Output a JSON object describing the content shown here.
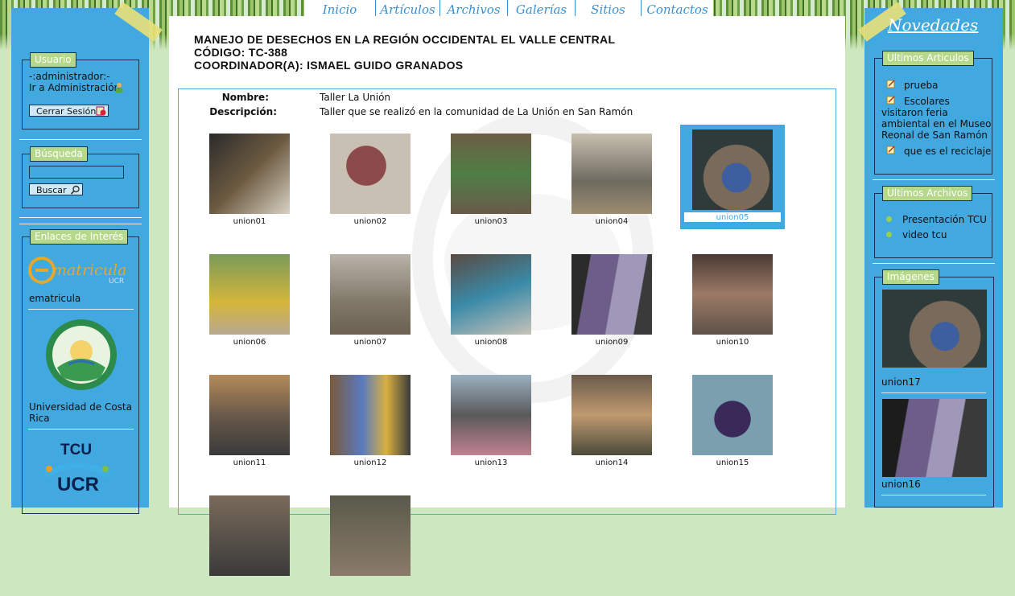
{
  "nav": [
    "Inicio",
    "Artículos",
    "Archivos",
    "Galerías",
    "Sitios",
    "Contactos"
  ],
  "left": {
    "usuario": {
      "legend": "Usuario",
      "line1": "-:administrador:-",
      "line2": "Ir a Administración",
      "logout": "Cerrar Sesión"
    },
    "busqueda": {
      "legend": "Búsqueda",
      "search_value": "",
      "search_button": "Buscar"
    },
    "enlaces": {
      "legend": "Enlaces de Interés",
      "items": [
        {
          "label": "ematricula",
          "logo_text": "matricula",
          "logo_sub": "UCR"
        },
        {
          "label": "Universidad de Costa Rica"
        },
        {
          "label": "TCU",
          "logo_top": "TCU",
          "logo_bottom": "UCR"
        }
      ]
    }
  },
  "main": {
    "title_line1": "MANEJO DE DESECHOS EN LA REGIÓN OCCIDENTAL EL VALLE CENTRAL",
    "title_line2": "CÓDIGO: TC-388",
    "title_line3": "COORDINADOR(A): ISMAEL GUIDO GRANADOS",
    "nombre_label": "Nombre:",
    "nombre_value": "Taller La Unión",
    "descripcion_label": "Descripción:",
    "descripcion_value": "Taller que se realizó en la comunidad de La Unión en San Ramón",
    "photos": [
      "union01",
      "union02",
      "union03",
      "union04",
      "union05",
      "union06",
      "union07",
      "union08",
      "union09",
      "union10",
      "union11",
      "union12",
      "union13",
      "union14",
      "union15",
      "",
      ""
    ],
    "selected_photo": "union05"
  },
  "right": {
    "title": "Novedades",
    "articulos": {
      "legend": "Ultimos Articulos",
      "items": [
        "prueba",
        "Escolares visitaron feria ambiental en el Museo Reonal de San Ramón",
        "que es el reciclaje"
      ]
    },
    "archivos": {
      "legend": "Ultimos Archivos",
      "items": [
        "Presentación TCU",
        "video tcu"
      ]
    },
    "imagenes": {
      "legend": "Imágenes",
      "items": [
        "union17",
        "union16"
      ]
    }
  },
  "colors": {
    "panel": "#41a8e0",
    "legend": "#b5d88b",
    "nav_text": "#3a8fd0"
  }
}
